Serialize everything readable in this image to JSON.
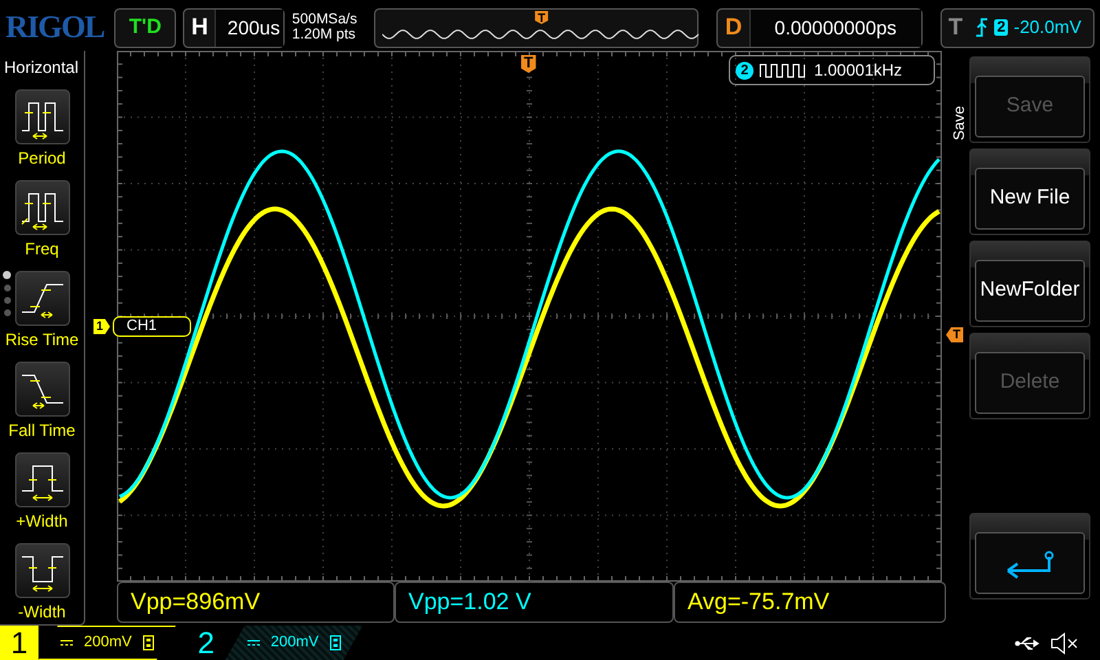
{
  "logo": "RIGOL",
  "run_status": "T'D",
  "timebase": {
    "label": "H",
    "value": "200us"
  },
  "acquisition": {
    "sample_rate": "500MSa/s",
    "memory_depth": "1.20M pts"
  },
  "memory_overview": {
    "trigger_marker": "T"
  },
  "delay": {
    "label": "D",
    "value": "0.00000000ps"
  },
  "trigger": {
    "label": "T",
    "source": "2",
    "level": "-20.0mV"
  },
  "measure_menu": {
    "title": "Horizontal",
    "items": [
      {
        "label": "Period",
        "kind": "period"
      },
      {
        "label": "Freq",
        "kind": "freq"
      },
      {
        "label": "Rise Time",
        "kind": "rise"
      },
      {
        "label": "Fall Time",
        "kind": "fall"
      },
      {
        "label": "+Width",
        "kind": "pwidth"
      },
      {
        "label": "-Width",
        "kind": "nwidth"
      }
    ],
    "page_dots": [
      {
        "selected": true
      },
      {
        "selected": false
      },
      {
        "selected": false
      },
      {
        "selected": false
      }
    ]
  },
  "screen": {
    "trigger_position_marker": "T",
    "frequency": {
      "channel": "2",
      "value": "1.00001kHz"
    },
    "channel_marker": {
      "number": "1",
      "label": "CH1"
    },
    "trigger_level_marker": "T"
  },
  "softkey_menu": {
    "title": "Save",
    "buttons": [
      {
        "kind": "text",
        "label": "Save",
        "disabled": true
      },
      {
        "kind": "text",
        "label": "New File",
        "disabled": false
      },
      {
        "kind": "text",
        "label": "NewFolder",
        "disabled": false
      },
      {
        "kind": "text",
        "label": "Delete",
        "disabled": true
      },
      {
        "kind": "back",
        "disabled": false
      }
    ]
  },
  "measurements": [
    {
      "text": "Vpp=896mV",
      "color": "#ffff00"
    },
    {
      "text": "Vpp=1.02 V",
      "color": "#00ffff"
    },
    {
      "text": "Avg=-75.7mV",
      "color": "#ffff00"
    }
  ],
  "channels": [
    {
      "number": "1",
      "scale": "200mV",
      "selected": true,
      "color": "#ffff00"
    },
    {
      "number": "2",
      "scale": "200mV",
      "selected": false,
      "color": "#00ffff"
    }
  ]
}
